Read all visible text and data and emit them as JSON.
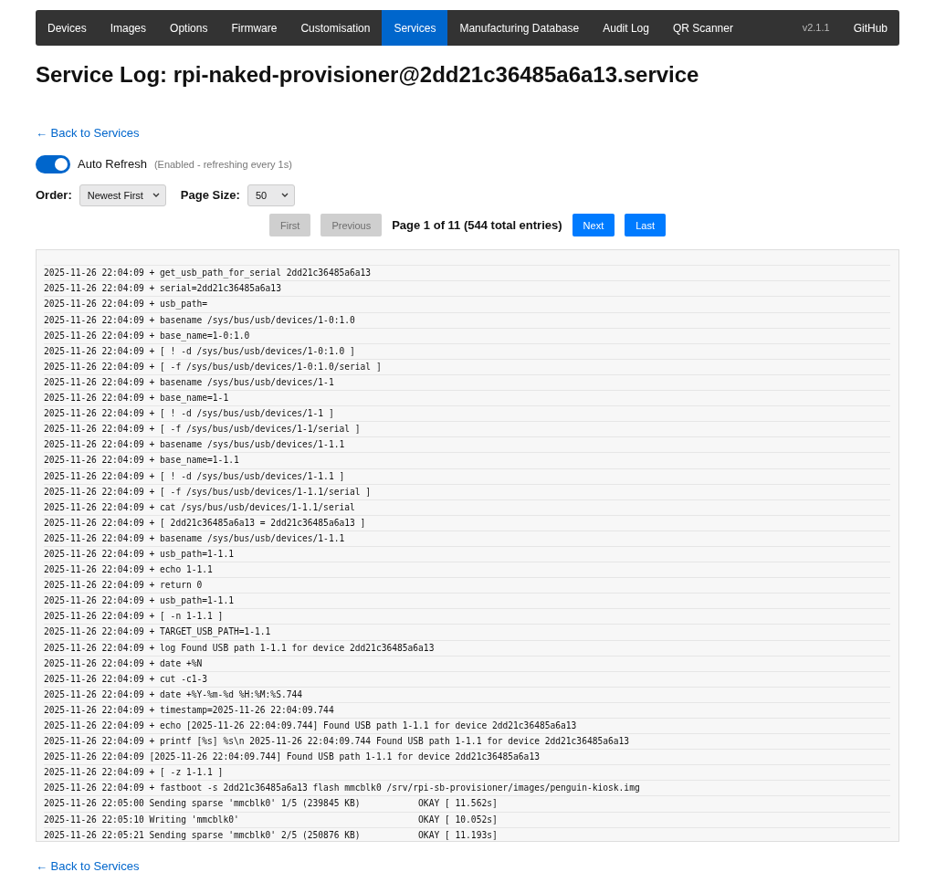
{
  "navbar": {
    "items": [
      {
        "label": "Devices",
        "selected": false
      },
      {
        "label": "Images",
        "selected": false
      },
      {
        "label": "Options",
        "selected": false
      },
      {
        "label": "Firmware",
        "selected": false
      },
      {
        "label": "Customisation",
        "selected": false
      },
      {
        "label": "Services",
        "selected": true
      },
      {
        "label": "Manufacturing Database",
        "selected": false
      },
      {
        "label": "Audit Log",
        "selected": false
      },
      {
        "label": "QR Scanner",
        "selected": false
      }
    ],
    "version": "v2.1.1",
    "github": "GitHub"
  },
  "title": "Service Log: rpi-naked-provisioner@2dd21c36485a6a13.service",
  "back_link_top": "← Back to Services",
  "auto_refresh": {
    "label": "Auto Refresh",
    "on": true,
    "status": "(Enabled - refreshing every 1s)"
  },
  "order": {
    "label": "Order:",
    "value": "Newest First"
  },
  "page_size": {
    "label": "Page Size:",
    "value": "50"
  },
  "pagination": {
    "buttons_before": [
      {
        "label": "First",
        "disabled": true
      },
      {
        "label": "Previous",
        "disabled": true
      }
    ],
    "info": "Page 1 of 11 (544 total entries)",
    "buttons_after": [
      {
        "label": "Next",
        "disabled": false
      },
      {
        "label": "Last",
        "disabled": false
      }
    ]
  },
  "log_lines": [
    "2025-11-26 22:04:09 + get_usb_path_for_serial 2dd21c36485a6a13",
    "2025-11-26 22:04:09 + serial=2dd21c36485a6a13",
    "2025-11-26 22:04:09 + usb_path=",
    "2025-11-26 22:04:09 + basename /sys/bus/usb/devices/1-0:1.0",
    "2025-11-26 22:04:09 + base_name=1-0:1.0",
    "2025-11-26 22:04:09 + [ ! -d /sys/bus/usb/devices/1-0:1.0 ]",
    "2025-11-26 22:04:09 + [ -f /sys/bus/usb/devices/1-0:1.0/serial ]",
    "2025-11-26 22:04:09 + basename /sys/bus/usb/devices/1-1",
    "2025-11-26 22:04:09 + base_name=1-1",
    "2025-11-26 22:04:09 + [ ! -d /sys/bus/usb/devices/1-1 ]",
    "2025-11-26 22:04:09 + [ -f /sys/bus/usb/devices/1-1/serial ]",
    "2025-11-26 22:04:09 + basename /sys/bus/usb/devices/1-1.1",
    "2025-11-26 22:04:09 + base_name=1-1.1",
    "2025-11-26 22:04:09 + [ ! -d /sys/bus/usb/devices/1-1.1 ]",
    "2025-11-26 22:04:09 + [ -f /sys/bus/usb/devices/1-1.1/serial ]",
    "2025-11-26 22:04:09 + cat /sys/bus/usb/devices/1-1.1/serial",
    "2025-11-26 22:04:09 + [ 2dd21c36485a6a13 = 2dd21c36485a6a13 ]",
    "2025-11-26 22:04:09 + basename /sys/bus/usb/devices/1-1.1",
    "2025-11-26 22:04:09 + usb_path=1-1.1",
    "2025-11-26 22:04:09 + echo 1-1.1",
    "2025-11-26 22:04:09 + return 0",
    "2025-11-26 22:04:09 + usb_path=1-1.1",
    "2025-11-26 22:04:09 + [ -n 1-1.1 ]",
    "2025-11-26 22:04:09 + TARGET_USB_PATH=1-1.1",
    "2025-11-26 22:04:09 + log Found USB path 1-1.1 for device 2dd21c36485a6a13",
    "2025-11-26 22:04:09 + date +%N",
    "2025-11-26 22:04:09 + cut -c1-3",
    "2025-11-26 22:04:09 + date +%Y-%m-%d %H:%M:%S.744",
    "2025-11-26 22:04:09 + timestamp=2025-11-26 22:04:09.744",
    "2025-11-26 22:04:09 + echo [2025-11-26 22:04:09.744] Found USB path 1-1.1 for device 2dd21c36485a6a13",
    "2025-11-26 22:04:09 + printf [%s] %s\\n 2025-11-26 22:04:09.744 Found USB path 1-1.1 for device 2dd21c36485a6a13",
    "2025-11-26 22:04:09 [2025-11-26 22:04:09.744] Found USB path 1-1.1 for device 2dd21c36485a6a13",
    "2025-11-26 22:04:09 + [ -z 1-1.1 ]",
    "2025-11-26 22:04:09 + fastboot -s 2dd21c36485a6a13 flash mmcblk0 /srv/rpi-sb-provisioner/images/penguin-kiosk.img",
    "2025-11-26 22:05:00 Sending sparse 'mmcblk0' 1/5 (239845 KB)           OKAY [ 11.562s]",
    "2025-11-26 22:05:10 Writing 'mmcblk0'                                  OKAY [ 10.052s]",
    "2025-11-26 22:05:21 Sending sparse 'mmcblk0' 2/5 (250876 KB)           OKAY [ 11.193s]"
  ],
  "back_link_bottom": "← Back to Services"
}
